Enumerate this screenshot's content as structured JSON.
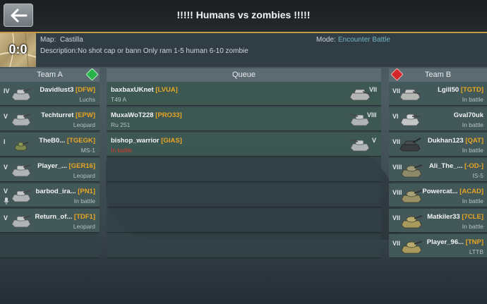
{
  "header": {
    "back_label": "back",
    "title": "!!!!! Humans vs zombies !!!!!"
  },
  "info": {
    "score": "0:0",
    "map_label": "Map:",
    "map_value": "Castilla",
    "description_label": "Description:",
    "description_value": "No shot cap or bann Only ram 1-5 human 6-10 zombie",
    "mode_label": "Mode:",
    "mode_value": "Encounter Battle"
  },
  "team_a": {
    "title": "Team A",
    "players": [
      {
        "tier": "IV",
        "name": "Davidlust3",
        "clan": "[DFW]",
        "sub": "Luchs",
        "icon": "light-tank-icon"
      },
      {
        "tier": "V",
        "name": "Techturret",
        "clan": "[EPW]",
        "sub": "Leopard",
        "icon": "light-tank-icon"
      },
      {
        "tier": "I",
        "name": "TheB0...",
        "clan": "[TGEGK]",
        "sub": "MS-1",
        "icon": "small-tank-icon"
      },
      {
        "tier": "V",
        "name": "Player_...",
        "clan": "[GER16]",
        "sub": "Leopard",
        "icon": "light-tank-icon"
      },
      {
        "tier": "V",
        "name": "barbod_ira...",
        "clan": "[PN1]",
        "sub": "In battle",
        "icon": "light-tank-icon"
      },
      {
        "tier": "V",
        "name": "Return_of...",
        "clan": "[TDF1]",
        "sub": "Leopard",
        "icon": "light-tank-icon"
      }
    ]
  },
  "queue": {
    "title": "Queue",
    "players": [
      {
        "tier": "VII",
        "name": "baxbaxUKnet",
        "clan": "[LVUA]",
        "sub": "T49 A",
        "icon": "td-tank-icon"
      },
      {
        "tier": "VIII",
        "name": "MuxaWoT228",
        "clan": "[PRO33]",
        "sub": "Ru 251",
        "icon": "light-tank-icon"
      },
      {
        "tier": "V",
        "name": "bishop_warrior",
        "clan": "[GIAS]",
        "sub": "In battle",
        "icon": "light-tank-icon"
      }
    ]
  },
  "team_b": {
    "title": "Team B",
    "players": [
      {
        "tier": "VII",
        "name": "Lgill50",
        "clan": "[TGTD]",
        "sub": "In battle",
        "icon": "td-tank-icon"
      },
      {
        "tier": "VI",
        "name": "Gval70uk",
        "clan": "",
        "sub": "In battle",
        "icon": "medium-tank-icon"
      },
      {
        "tier": "VII",
        "name": "Dukhan123",
        "clan": "[QAT]",
        "sub": "In battle",
        "icon": "td-tank-icon"
      },
      {
        "tier": "VIII",
        "name": "Ali_The_...",
        "clan": "[-OD-]",
        "sub": "IS-5",
        "icon": "heavy-tank-icon"
      },
      {
        "tier": "VIII",
        "name": "Powercat...",
        "clan": "[ACAD]",
        "sub": "In battle",
        "icon": "heavy-tank-icon"
      },
      {
        "tier": "VII",
        "name": "Matkiler33",
        "clan": "[7CLE]",
        "sub": "In battle",
        "icon": "heavy-tank-icon"
      },
      {
        "tier": "VII",
        "name": "Player_96...",
        "clan": "[TNP]",
        "sub": "LTTB",
        "icon": "heavy-tank-icon"
      }
    ]
  },
  "colors": {
    "accent_gold": "#c39b46",
    "clan": "#e7a623",
    "team_a_marker": "#27b34a",
    "team_b_marker": "#d3272b"
  }
}
